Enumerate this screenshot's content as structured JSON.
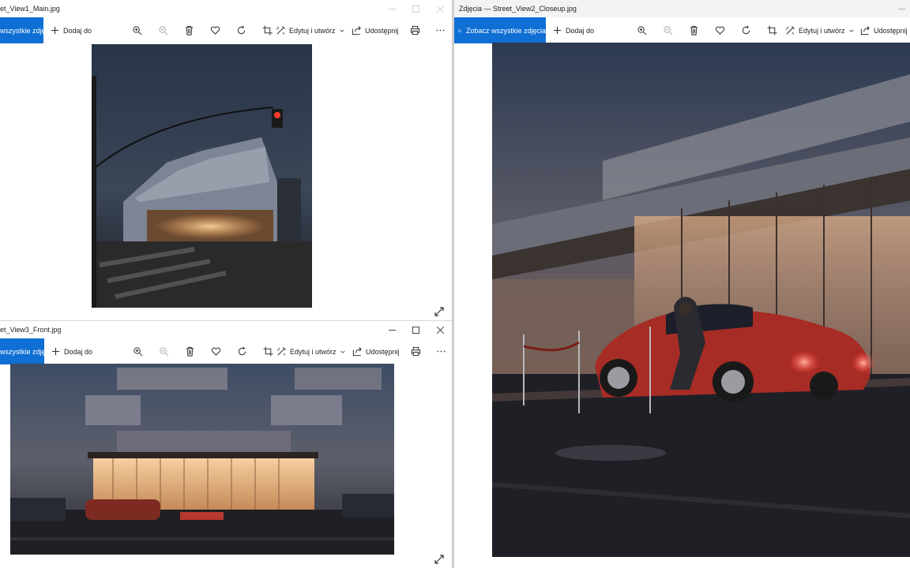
{
  "windows": [
    {
      "id": "top-left",
      "title": "et_View1_Main.jpg",
      "see_all_label": "wszystkie zdjęcia",
      "add_label": "Dodaj do",
      "edit_label": "Edytuj i utwórz",
      "share_label": "Udostępnij"
    },
    {
      "id": "bottom-left",
      "title": "et_View3_Front.jpg",
      "see_all_label": "wszystkie zdjęcia",
      "add_label": "Dodaj do",
      "edit_label": "Edytuj i utwórz",
      "share_label": "Udostępnij"
    },
    {
      "id": "right",
      "title": "Zdjęcia — Street_View2_Closeup.jpg",
      "see_all_label": "Zobacz wszystkie zdjęcia",
      "add_label": "Dodaj do",
      "edit_label": "Edytuj i utwórz",
      "share_label": "Udostępnij"
    }
  ],
  "icons": [
    "plus-icon",
    "zoom-in-icon",
    "zoom-out-icon",
    "trash-icon",
    "heart-icon",
    "rotate-icon",
    "crop-icon",
    "magic-edit-icon",
    "chevron-down-icon",
    "share-icon",
    "print-icon",
    "more-icon",
    "minimize-icon",
    "maximize-icon",
    "close-icon",
    "expand-icon",
    "gallery-icon"
  ],
  "colors": {
    "accent": "#0f6fd4"
  }
}
